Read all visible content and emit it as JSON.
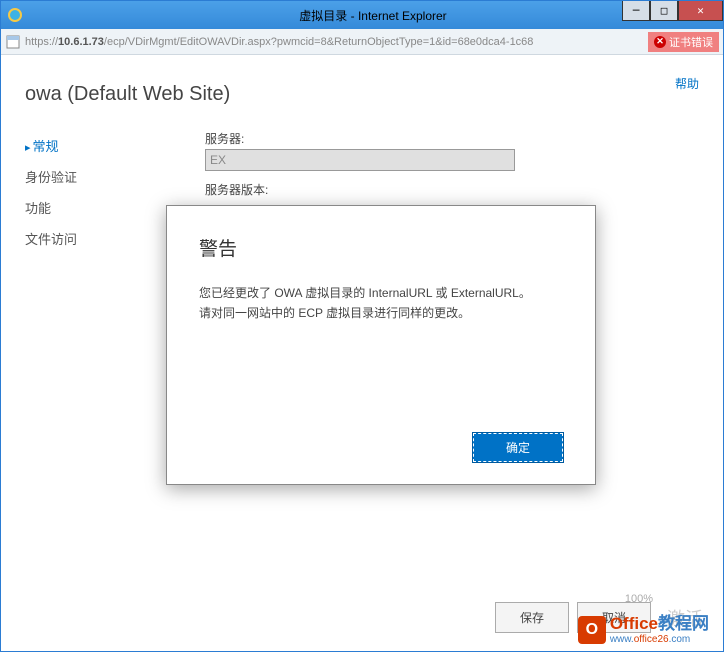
{
  "window": {
    "title": "虚拟目录 - Internet Explorer",
    "minimize": "─",
    "maximize": "□",
    "close": "✕"
  },
  "addressbar": {
    "url_prefix": "https://",
    "url_host": "10.6.1.73",
    "url_path": "/ecp/VDirMgmt/EditOWAVDir.aspx?pwmcid=8&ReturnObjectType=1&id=68e0dca4-1c68",
    "cert_error": "证书错误"
  },
  "page": {
    "help": "帮助",
    "title": "owa (Default Web Site)"
  },
  "sidebar": {
    "items": [
      {
        "label": "常规",
        "active": true
      },
      {
        "label": "身份验证",
        "active": false
      },
      {
        "label": "功能",
        "active": false
      },
      {
        "label": "文件访问",
        "active": false
      }
    ]
  },
  "form": {
    "server_label": "服务器:",
    "server_value": "EX",
    "version_label": "服务器版本:"
  },
  "modal": {
    "title": "警告",
    "line1": "您已经更改了 OWA 虚拟目录的 InternalURL 或 ExternalURL。",
    "line2": "请对同一网站中的 ECP 虚拟目录进行同样的更改。",
    "ok": "确定"
  },
  "footer": {
    "save": "保存",
    "cancel": "取消",
    "activate": "激活",
    "zoom": "100%"
  },
  "watermark": {
    "brand1": "Office",
    "brand2": "教程网",
    "url1": "www.",
    "url2": "office26",
    "url3": ".com"
  }
}
